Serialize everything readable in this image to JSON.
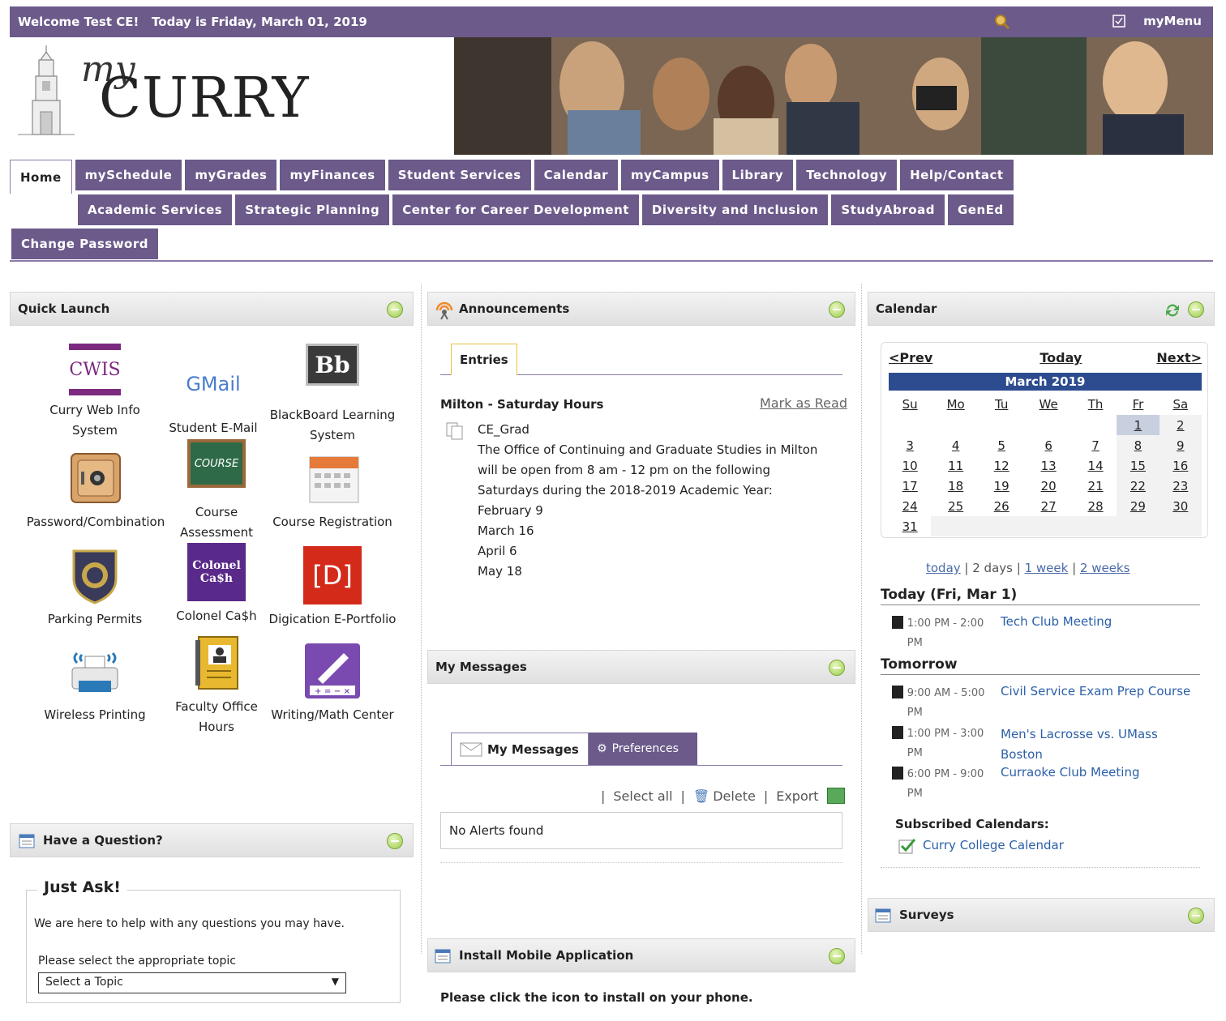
{
  "header": {
    "welcome": "Welcome Test CE!   Today is Friday, March 01, 2019",
    "mymenu_label": "myMenu"
  },
  "logo": {
    "my": "my",
    "curry": "CURRY"
  },
  "nav": {
    "row1": [
      "Home",
      "mySchedule",
      "myGrades",
      "myFinances",
      "Student Services",
      "Calendar",
      "myCampus",
      "Library",
      "Technology",
      "Help/Contact"
    ],
    "row2": [
      "Academic Services",
      "Strategic Planning",
      "Center for Career Development",
      "Diversity and Inclusion",
      "StudyAbroad",
      "GenEd"
    ],
    "row3": [
      "Change Password"
    ]
  },
  "quick_launch": {
    "title": "Quick Launch",
    "items": [
      {
        "label": "Curry Web Info System",
        "icon": "CWIS"
      },
      {
        "label": "Student E-Mail",
        "icon": "GMail"
      },
      {
        "label": "BlackBoard Learning System",
        "icon": "Bb"
      },
      {
        "label": "Password/Combination",
        "icon": "safe"
      },
      {
        "label": "Course Assessment",
        "icon": "COURSE"
      },
      {
        "label": "Course Registration",
        "icon": "calendar"
      },
      {
        "label": "Parking Permits",
        "icon": "badge"
      },
      {
        "label": "Colonel Ca$h",
        "icon": "Colonel Ca$h"
      },
      {
        "label": "Digication E-Portfolio",
        "icon": "[D]"
      },
      {
        "label": "Wireless Printing",
        "icon": "printer"
      },
      {
        "label": "Faculty Office Hours",
        "icon": "book"
      },
      {
        "label": "Writing/Math Center",
        "icon": "pen"
      }
    ]
  },
  "question": {
    "title": "Have a Question?",
    "heading": "Just Ask!",
    "text": "We are here to help with any questions you may have.",
    "topic_label": "Please select the appropriate topic",
    "select_value": "Select a Topic"
  },
  "announcements": {
    "title": "Announcements",
    "tab": "Entries",
    "item_title": "Milton - Saturday Hours",
    "mark_read": "Mark as Read",
    "author": "CE_Grad",
    "body": [
      "The Office of Continuing and Graduate Studies in Milton",
      "will be open from 8 am - 12 pm on the following",
      "Saturdays during the 2018-2019 Academic Year:",
      "February 9",
      "March 16",
      "April 6",
      "May 18"
    ]
  },
  "messages": {
    "title": "My Messages",
    "tab_messages": "My Messages",
    "tab_prefs": "Preferences",
    "select_all": "Select all",
    "delete": "Delete",
    "export": "Export",
    "empty": "No Alerts found"
  },
  "mobile": {
    "title": "Install Mobile Application",
    "text": "Please click the icon to install on your phone."
  },
  "calendar": {
    "title": "Calendar",
    "prev": "<Prev",
    "today": "Today",
    "next": "Next>",
    "month": "March 2019",
    "days": [
      "Su",
      "Mo",
      "Tu",
      "We",
      "Th",
      "Fr",
      "Sa"
    ],
    "weeks": [
      [
        "",
        "",
        "",
        "",
        "",
        "1",
        "2"
      ],
      [
        "3",
        "4",
        "5",
        "6",
        "7",
        "8",
        "9"
      ],
      [
        "10",
        "11",
        "12",
        "13",
        "14",
        "15",
        "16"
      ],
      [
        "17",
        "18",
        "19",
        "20",
        "21",
        "22",
        "23"
      ],
      [
        "24",
        "25",
        "26",
        "27",
        "28",
        "29",
        "30"
      ],
      [
        "31",
        "",
        "",
        "",
        "",
        "",
        ""
      ]
    ],
    "views": {
      "today": "today",
      "two_days": "2 days",
      "week": "1 week",
      "weeks": "2 weeks"
    },
    "today_heading": "Today (Fri, Mar 1)",
    "today_events": [
      {
        "time": "1:00 PM - 2:00 PM",
        "title": "Tech Club Meeting"
      }
    ],
    "tomorrow_heading": "Tomorrow",
    "tomorrow_events": [
      {
        "time": "9:00 AM - 5:00 PM",
        "title": "Civil Service Exam Prep Course"
      },
      {
        "time": "1:00 PM - 3:00 PM",
        "title": "Men's Lacrosse vs. UMass Boston"
      },
      {
        "time": "6:00 PM - 9:00 PM",
        "title": "Curraoke Club Meeting"
      }
    ],
    "subscribed_label": "Subscribed Calendars:",
    "subscribed": "Curry College Calendar"
  },
  "surveys": {
    "title": "Surveys"
  },
  "colors": {
    "purple": "#6b5a8a",
    "link_blue": "#2b5fa8",
    "calendar_header": "#2d4c8f"
  }
}
